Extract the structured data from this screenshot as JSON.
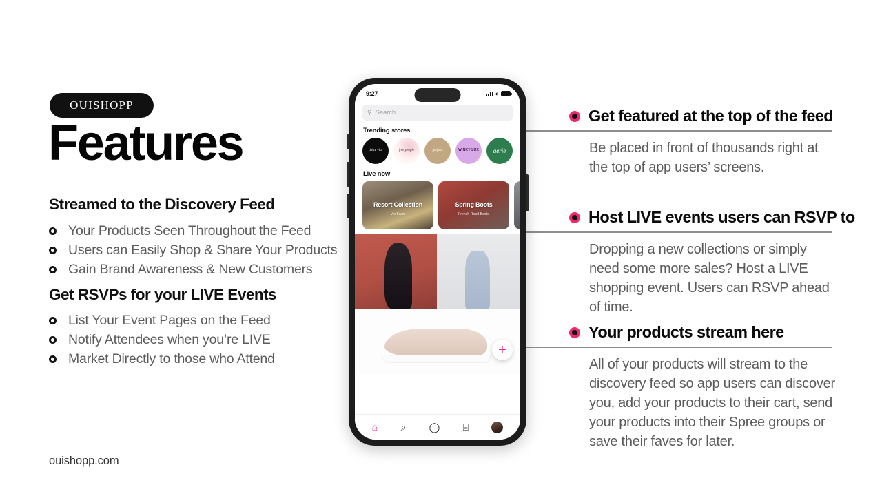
{
  "brand": {
    "pill_label": "OUISHOPP",
    "page_title": "Features",
    "footer_url": "ouishopp.com"
  },
  "left": {
    "sections": [
      {
        "heading": "Streamed to the Discovery Feed",
        "bullets": [
          "Your Products Seen Throughout the Feed",
          "Users can Easily Shop & Share Your Products",
          "Gain Brand Awareness & New Customers"
        ]
      },
      {
        "heading": "Get RSVPs for your LIVE Events",
        "bullets": [
          "List Your Event Pages on the Feed",
          "Notify Attendees when you’re LIVE",
          "Market Directly to those who Attend"
        ]
      }
    ]
  },
  "right": {
    "features": [
      {
        "heading": "Get featured at the top of the feed",
        "body": "Be placed in front of thousands right at the top of app users’ screens."
      },
      {
        "heading": "Host LIVE events users can RSVP to",
        "body": "Dropping a new collections or simply need some more sales? Host a LIVE shopping event. Users can RSVP ahead of time."
      },
      {
        "heading": "Your products stream here",
        "body": "All of your products will stream to the discovery feed so app users can discover you, add your products to their cart, send your products into their Spree groups or save their faves for later."
      }
    ]
  },
  "phone": {
    "status": {
      "time": "9:27",
      "cellular": "signal-bars-icon",
      "wifi": "wifi-icon",
      "battery": "battery-icon"
    },
    "search": {
      "placeholder": "Search",
      "icon": "search-icon"
    },
    "trending": {
      "label": "Trending stores",
      "stores": [
        {
          "name": "dolce vita"
        },
        {
          "name": "free people"
        },
        {
          "name": "gorjana"
        },
        {
          "name": "WINKY LUX"
        },
        {
          "name": "aerie"
        }
      ]
    },
    "live": {
      "label": "Live now",
      "cards": [
        {
          "title": "Resort Collection",
          "subtitle": "Vix Swim"
        },
        {
          "title": "Spring Boots",
          "subtitle": "French Road Boots"
        },
        {
          "title": "",
          "subtitle": ""
        }
      ]
    },
    "fab": {
      "label": "+"
    },
    "tabs": [
      {
        "name": "home",
        "glyph": "⌂"
      },
      {
        "name": "search",
        "glyph": "⌕"
      },
      {
        "name": "chat",
        "glyph": "◯"
      },
      {
        "name": "cart",
        "glyph": "⌸"
      },
      {
        "name": "profile",
        "glyph": ""
      }
    ]
  },
  "colors": {
    "accent_pink": "#f0266e",
    "fab_pink": "#f5277a",
    "ink": "#0b0b0b",
    "body_gray": "#5b5b5b",
    "divider": "#8e8e8e"
  }
}
